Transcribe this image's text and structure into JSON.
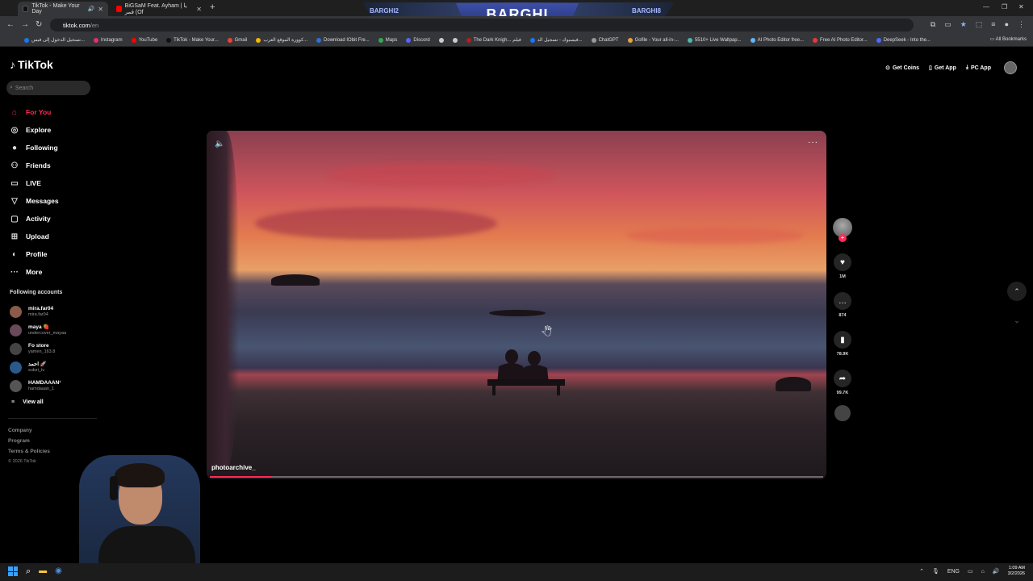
{
  "browser": {
    "tabs": [
      {
        "title": "TikTok - Make Your Day",
        "active": true,
        "favicon_color": "#111111"
      },
      {
        "title": "BiGSaM Feat. Ayham | يا قمر (Of",
        "active": false,
        "favicon_color": "#ff0000"
      }
    ],
    "url_host": "tiktok.com",
    "url_path": "/en",
    "bookmarks": [
      {
        "label": "تسجيل الدخول إلى فيس...",
        "color": "#1877f2"
      },
      {
        "label": "Instagram",
        "color": "#e1306c"
      },
      {
        "label": "YouTube",
        "color": "#ff0000"
      },
      {
        "label": "TikTok - Make Your...",
        "color": "#111111"
      },
      {
        "label": "Gmail",
        "color": "#ea4335"
      },
      {
        "label": "كوورة الموقع العرب...",
        "color": "#f2b705"
      },
      {
        "label": "Download IObit Fre...",
        "color": "#2f6fd6"
      },
      {
        "label": "Maps",
        "color": "#34a853"
      },
      {
        "label": "Discord",
        "color": "#5865f2"
      },
      {
        "label": "",
        "color": "#cccccc"
      },
      {
        "label": "",
        "color": "#cccccc"
      },
      {
        "label": "The Dark Knigh... فيلم",
        "color": "#b11f1f"
      },
      {
        "label": "فيسبوك - تسجيل الد...",
        "color": "#1877f2"
      },
      {
        "label": "ChatGPT",
        "color": "#999999"
      },
      {
        "label": "Gofile - Your all-in-...",
        "color": "#e6a23c"
      },
      {
        "label": "5510+ Live Wallpap...",
        "color": "#4db6ac"
      },
      {
        "label": "AI Photo Editor free...",
        "color": "#64b5f6"
      },
      {
        "label": "Free AI Photo Editor...",
        "color": "#e53935"
      },
      {
        "label": "DeepSeek - Into the...",
        "color": "#4d6bfe"
      }
    ],
    "all_bookmarks_label": "All Bookmarks"
  },
  "overlay_banner": {
    "main": "BARGHI",
    "left": "BARGHI2",
    "right": "BARGHI8"
  },
  "tiktok": {
    "logo": "TikTok",
    "search_placeholder": "Search",
    "nav": [
      {
        "label": "For You",
        "icon": "home-icon",
        "active": true
      },
      {
        "label": "Explore",
        "icon": "compass-icon",
        "active": false
      },
      {
        "label": "Following",
        "icon": "following-avatar-icon",
        "active": false
      },
      {
        "label": "Friends",
        "icon": "friends-icon",
        "active": false
      },
      {
        "label": "LIVE",
        "icon": "live-icon",
        "active": false
      },
      {
        "label": "Messages",
        "icon": "messages-icon",
        "active": false
      },
      {
        "label": "Activity",
        "icon": "activity-icon",
        "active": false
      },
      {
        "label": "Upload",
        "icon": "upload-icon",
        "active": false
      },
      {
        "label": "Profile",
        "icon": "profile-icon",
        "active": false
      },
      {
        "label": "More",
        "icon": "more-icon",
        "active": false
      }
    ],
    "following_accounts_title": "Following accounts",
    "accounts": [
      {
        "name": "mira.far04",
        "username": "mira.far04"
      },
      {
        "name": "maya 🍓",
        "username": "undercover_mayaa"
      },
      {
        "name": "Fo store",
        "username": "yamen_163.8"
      },
      {
        "name": "احمد 🚀",
        "username": "subzi_tv"
      },
      {
        "name": "HAMDAAAN¹",
        "username": "hamdaaan_1"
      }
    ],
    "view_all": "View all",
    "footer": {
      "company": "Company",
      "program": "Program",
      "terms": "Terms & Policies",
      "copyright": "© 2026 TikTok"
    },
    "top_right": {
      "get_coins": "Get Coins",
      "get_app": "Get App",
      "pc_app": "PC App"
    },
    "video": {
      "author": "photoarchive_",
      "progress": 0.1
    },
    "actions": {
      "likes": "1M",
      "comments": "874",
      "saves": "78.9K",
      "shares": "99.7K"
    }
  },
  "taskbar": {
    "language": "ENG",
    "time": "1:09 AM",
    "date": "3/2/2026"
  }
}
